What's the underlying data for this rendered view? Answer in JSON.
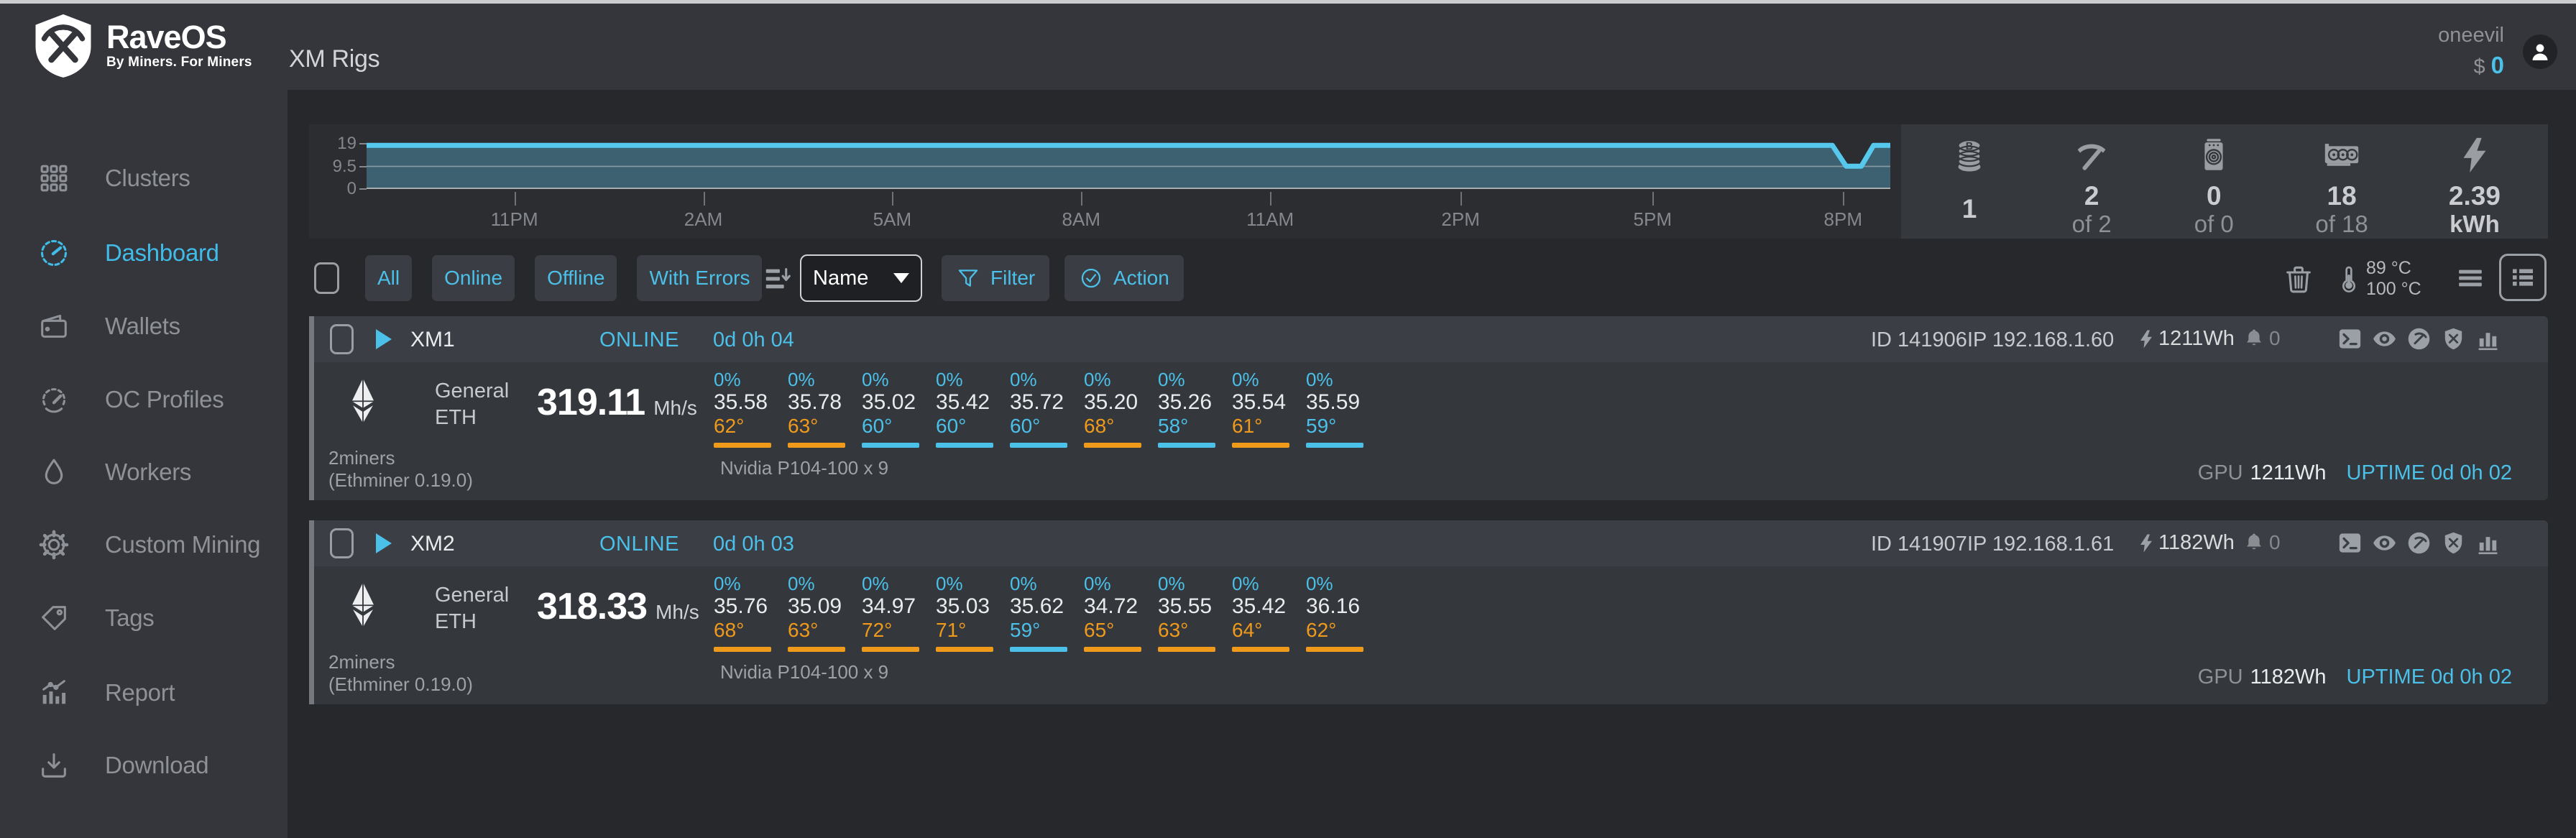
{
  "colors": {
    "accent": "#4bc0e8",
    "hot": "#f09a1c",
    "cool": "#4bc0e8",
    "chart_fill": "#3d6170",
    "chart_line": "#55c8ec"
  },
  "header": {
    "logo_title": "RaveOS",
    "logo_subtitle": "By Miners. For Miners",
    "page_title": "XM Rigs",
    "username": "oneevil",
    "balance_currency": "$",
    "balance_value": "0"
  },
  "sidebar": {
    "items": [
      {
        "label": "Clusters",
        "icon": "clusters-grid-icon",
        "active": false
      },
      {
        "label": "Dashboard",
        "icon": "speedometer-icon",
        "active": true
      },
      {
        "label": "Wallets",
        "icon": "wallet-icon",
        "active": false
      },
      {
        "label": "OC Profiles",
        "icon": "gauge-icon",
        "active": false
      },
      {
        "label": "Workers",
        "icon": "droplet-icon",
        "active": false
      },
      {
        "label": "Custom Mining",
        "icon": "gear-icon",
        "active": false
      },
      {
        "label": "Tags",
        "icon": "tag-icon",
        "active": false
      },
      {
        "label": "Report",
        "icon": "report-chart-icon",
        "active": false
      },
      {
        "label": "Download",
        "icon": "download-icon",
        "active": false
      }
    ]
  },
  "chart_data": {
    "type": "area",
    "title": "",
    "xlabel": "",
    "ylabel": "",
    "ylim": [
      0,
      19
    ],
    "grid": true,
    "y_ticks": [
      {
        "label": "0",
        "v": 0
      },
      {
        "label": "9.5",
        "v": 9.5
      },
      {
        "label": "19",
        "v": 19
      }
    ],
    "x_ticks": [
      {
        "label": "11PM",
        "pos": 0.097
      },
      {
        "label": "2AM",
        "pos": 0.221
      },
      {
        "label": "5AM",
        "pos": 0.345
      },
      {
        "label": "8AM",
        "pos": 0.469
      },
      {
        "label": "11AM",
        "pos": 0.593
      },
      {
        "label": "2PM",
        "pos": 0.718
      },
      {
        "label": "5PM",
        "pos": 0.844
      },
      {
        "label": "8PM",
        "pos": 0.969
      }
    ],
    "series": [
      {
        "name": "total-hashrate",
        "points": [
          [
            0,
            18.3
          ],
          [
            0.962,
            18.3
          ],
          [
            0.971,
            9.6
          ],
          [
            0.981,
            9.6
          ],
          [
            0.989,
            18.3
          ],
          [
            1,
            18.3
          ]
        ]
      }
    ]
  },
  "stats": [
    {
      "icon": "coin-stack-icon",
      "value": "1",
      "sub": "",
      "solo": true,
      "bold_sub": false
    },
    {
      "icon": "pickaxe-icon",
      "value": "2",
      "sub": "of 2",
      "solo": false,
      "bold_sub": false
    },
    {
      "icon": "asic-miner-icon",
      "value": "0",
      "sub": "of 0",
      "solo": false,
      "bold_sub": false
    },
    {
      "icon": "gpu-card-icon",
      "value": "18",
      "sub": "of 18",
      "solo": false,
      "bold_sub": false
    },
    {
      "icon": "energy-bolt-icon",
      "value": "2.39",
      "sub": "kWh",
      "solo": false,
      "bold_sub": true
    }
  ],
  "filter_bar": {
    "filters": [
      {
        "label": "All"
      },
      {
        "label": "Online"
      },
      {
        "label": "Offline"
      },
      {
        "label": "With Errors"
      }
    ],
    "sort_value": "Name",
    "filter_label": "Filter",
    "action_label": "Action",
    "temp_min": "89 °C",
    "temp_max": "100 °C"
  },
  "rigs": [
    {
      "name": "XM1",
      "status": "ONLINE",
      "uptime": "0d 0h 04",
      "id_label": "ID",
      "id": "141906",
      "ip_label": "IP",
      "ip": "192.168.1.60",
      "power": "1211Wh",
      "alarms": "0",
      "pool": "General",
      "coin": "ETH",
      "hashrate": "319.11",
      "hashrate_unit": "Mh/s",
      "gpus": [
        {
          "load": "0%",
          "hash": "35.58",
          "temp": "62°",
          "hot": true
        },
        {
          "load": "0%",
          "hash": "35.78",
          "temp": "63°",
          "hot": true
        },
        {
          "load": "0%",
          "hash": "35.02",
          "temp": "60°",
          "hot": false
        },
        {
          "load": "0%",
          "hash": "35.42",
          "temp": "60°",
          "hot": false
        },
        {
          "load": "0%",
          "hash": "35.72",
          "temp": "60°",
          "hot": false
        },
        {
          "load": "0%",
          "hash": "35.20",
          "temp": "68°",
          "hot": true
        },
        {
          "load": "0%",
          "hash": "35.26",
          "temp": "58°",
          "hot": false
        },
        {
          "load": "0%",
          "hash": "35.54",
          "temp": "61°",
          "hot": true
        },
        {
          "load": "0%",
          "hash": "35.59",
          "temp": "59°",
          "hot": false
        }
      ],
      "miner": "2miners",
      "miner_version": "(Ethminer 0.19.0)",
      "hardware": "Nvidia P104-100 x 9",
      "footer_power_label": "GPU",
      "footer_power": "1211Wh",
      "footer_uptime": "UPTIME 0d 0h 02"
    },
    {
      "name": "XM2",
      "status": "ONLINE",
      "uptime": "0d 0h 03",
      "id_label": "ID",
      "id": "141907",
      "ip_label": "IP",
      "ip": "192.168.1.61",
      "power": "1182Wh",
      "alarms": "0",
      "pool": "General",
      "coin": "ETH",
      "hashrate": "318.33",
      "hashrate_unit": "Mh/s",
      "gpus": [
        {
          "load": "0%",
          "hash": "35.76",
          "temp": "68°",
          "hot": true
        },
        {
          "load": "0%",
          "hash": "35.09",
          "temp": "63°",
          "hot": true
        },
        {
          "load": "0%",
          "hash": "34.97",
          "temp": "72°",
          "hot": true
        },
        {
          "load": "0%",
          "hash": "35.03",
          "temp": "71°",
          "hot": true
        },
        {
          "load": "0%",
          "hash": "35.62",
          "temp": "59°",
          "hot": false
        },
        {
          "load": "0%",
          "hash": "34.72",
          "temp": "65°",
          "hot": true
        },
        {
          "load": "0%",
          "hash": "35.55",
          "temp": "63°",
          "hot": true
        },
        {
          "load": "0%",
          "hash": "35.42",
          "temp": "64°",
          "hot": true
        },
        {
          "load": "0%",
          "hash": "36.16",
          "temp": "62°",
          "hot": true
        }
      ],
      "miner": "2miners",
      "miner_version": "(Ethminer 0.19.0)",
      "hardware": "Nvidia P104-100 x 9",
      "footer_power_label": "GPU",
      "footer_power": "1182Wh",
      "footer_uptime": "UPTIME 0d 0h 02"
    }
  ]
}
